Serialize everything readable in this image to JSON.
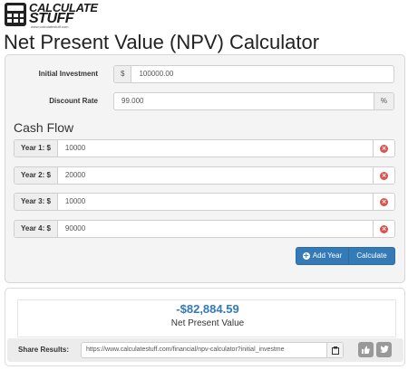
{
  "logo": {
    "line1": "CALCULATE",
    "line2": "STUFF",
    "tagline": "www.calculatestuff.com"
  },
  "page_title": "Net Present Value (NPV) Calculator",
  "form": {
    "initial_investment": {
      "label": "Initial Investment",
      "prefix": "$",
      "value": "100000.00"
    },
    "discount_rate": {
      "label": "Discount Rate",
      "value": "99.000",
      "suffix": "%"
    },
    "cash_flow": {
      "title": "Cash Flow",
      "years": [
        {
          "label": "Year 1: $",
          "value": "10000"
        },
        {
          "label": "Year 2: $",
          "value": "20000"
        },
        {
          "label": "Year 3: $",
          "value": "10000"
        },
        {
          "label": "Year 4: $",
          "value": "90000"
        }
      ]
    },
    "add_year_label": "Add Year",
    "calculate_label": "Calculate"
  },
  "result": {
    "value": "-$82,884.59",
    "label": "Net Present Value"
  },
  "share": {
    "label": "Share Results:",
    "url": "https://www.calculatestuff.com/financial/npv-calculator?initial_investme"
  },
  "colors": {
    "accent": "#337ab7",
    "remove": "#d9534f"
  },
  "icons": {
    "remove": "x-circle-icon",
    "add": "plus-circle-icon",
    "copy": "clipboard-icon",
    "like": "thumbs-up-icon",
    "twitter": "twitter-icon"
  }
}
